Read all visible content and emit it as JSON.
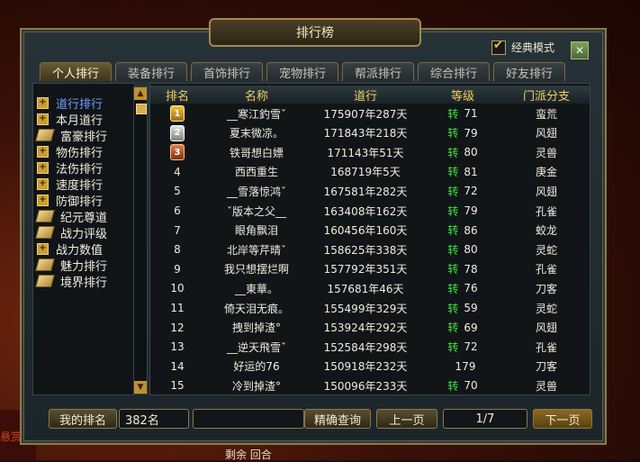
{
  "window": {
    "title": "排行榜",
    "classic_mode_label": "经典模式",
    "close_icon": "✕"
  },
  "tabs": [
    {
      "label": "个人排行",
      "active": true
    },
    {
      "label": "装备排行"
    },
    {
      "label": "首饰排行"
    },
    {
      "label": "宠物排行"
    },
    {
      "label": "帮派排行"
    },
    {
      "label": "综合排行"
    },
    {
      "label": "好友排行"
    }
  ],
  "sidebar": {
    "items": [
      {
        "label": "道行排行",
        "icon": "plus-icon",
        "active": true
      },
      {
        "label": "本月道行",
        "icon": "plus-icon"
      },
      {
        "label": "富豪排行",
        "icon": "book-icon"
      },
      {
        "label": "物伤排行",
        "icon": "plus-icon"
      },
      {
        "label": "法伤排行",
        "icon": "plus-icon"
      },
      {
        "label": "速度排行",
        "icon": "plus-icon"
      },
      {
        "label": "防御排行",
        "icon": "plus-icon"
      },
      {
        "label": "纪元尊道",
        "icon": "book-icon"
      },
      {
        "label": "战力评级",
        "icon": "book-icon"
      },
      {
        "label": "战力数值",
        "icon": "plus-icon"
      },
      {
        "label": "魅力排行",
        "icon": "book-icon"
      },
      {
        "label": "境界排行",
        "icon": "book-icon"
      }
    ]
  },
  "table": {
    "headers": [
      "排名",
      "名称",
      "道行",
      "等级",
      "门派分支"
    ],
    "rows": [
      {
        "rank": "1",
        "name": "__寒江釣雪ˇ",
        "daohang": "175907年287天",
        "zhuan": "转",
        "level": "71",
        "branch": "蛮荒"
      },
      {
        "rank": "2",
        "name": "夏末微凉。",
        "daohang": "171843年218天",
        "zhuan": "转",
        "level": "79",
        "branch": "风翅"
      },
      {
        "rank": "3",
        "name": "铁哥想白嫖",
        "daohang": "171143年51天",
        "zhuan": "转",
        "level": "80",
        "branch": "灵兽"
      },
      {
        "rank": "4",
        "name": "西西重生",
        "daohang": "168719年5天",
        "zhuan": "转",
        "level": "81",
        "branch": "庚金"
      },
      {
        "rank": "5",
        "name": "__雪落惊鸿ˇ",
        "daohang": "167581年282天",
        "zhuan": "转",
        "level": "72",
        "branch": "风翅"
      },
      {
        "rank": "6",
        "name": "ˇ版本之父__",
        "daohang": "163408年162天",
        "zhuan": "转",
        "level": "79",
        "branch": "孔雀"
      },
      {
        "rank": "7",
        "name": "眼角飘泪",
        "daohang": "160456年160天",
        "zhuan": "转",
        "level": "86",
        "branch": "蛟龙"
      },
      {
        "rank": "8",
        "name": "北岸等芹晴ˇ",
        "daohang": "158625年338天",
        "zhuan": "转",
        "level": "80",
        "branch": "灵蛇"
      },
      {
        "rank": "9",
        "name": "我只想摆烂啊",
        "daohang": "157792年351天",
        "zhuan": "转",
        "level": "78",
        "branch": "孔雀"
      },
      {
        "rank": "10",
        "name": "__東華。",
        "daohang": "157681年46天",
        "zhuan": "转",
        "level": "76",
        "branch": "刀客"
      },
      {
        "rank": "11",
        "name": "倚天泪无痕。",
        "daohang": "155499年329天",
        "zhuan": "转",
        "level": "59",
        "branch": "灵蛇"
      },
      {
        "rank": "12",
        "name": "拽到掉渣°",
        "daohang": "153924年292天",
        "zhuan": "转",
        "level": "69",
        "branch": "风翅"
      },
      {
        "rank": "13",
        "name": "__逆天飛雪ˇ",
        "daohang": "152584年298天",
        "zhuan": "转",
        "level": "72",
        "branch": "孔雀"
      },
      {
        "rank": "14",
        "name": "好运的76",
        "daohang": "150918年232天",
        "zhuan": "",
        "level": "179",
        "branch": "刀客"
      },
      {
        "rank": "15",
        "name": "冷到掉渣°",
        "daohang": "150096年233天",
        "zhuan": "转",
        "level": "70",
        "branch": "灵兽"
      }
    ]
  },
  "footer": {
    "my_rank_label": "我的排名",
    "my_rank_value": "382名",
    "search_value": "",
    "precise_search_label": "精确查询",
    "prev_label": "上一页",
    "page_indicator": "1/7",
    "next_label": "下一页"
  },
  "background": {
    "left_text": "悬赏",
    "bottom_text": "剩余   回合"
  }
}
